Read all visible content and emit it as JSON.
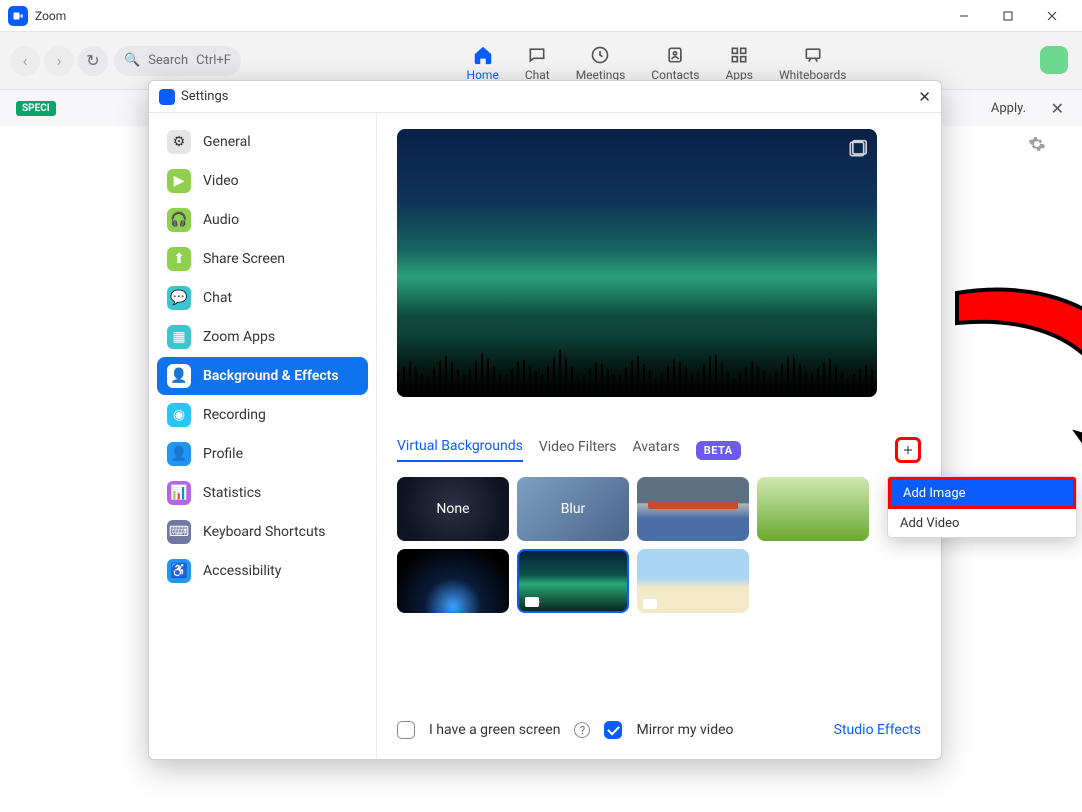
{
  "app": {
    "title": "Zoom"
  },
  "window_controls": {
    "minimize": "minimize",
    "maximize": "maximize",
    "close": "close"
  },
  "toolbar": {
    "search_label": "Search",
    "search_shortcut": "Ctrl+F",
    "tabs": [
      {
        "label": "Home"
      },
      {
        "label": "Chat"
      },
      {
        "label": "Meetings"
      },
      {
        "label": "Contacts"
      },
      {
        "label": "Apps"
      },
      {
        "label": "Whiteboards"
      }
    ]
  },
  "banner": {
    "pill": "SPECI",
    "tail_text": "Apply."
  },
  "settings": {
    "title": "Settings",
    "sidebar": [
      {
        "label": "General",
        "icon": "gear"
      },
      {
        "label": "Video",
        "icon": "video"
      },
      {
        "label": "Audio",
        "icon": "audio"
      },
      {
        "label": "Share Screen",
        "icon": "share"
      },
      {
        "label": "Chat",
        "icon": "chat"
      },
      {
        "label": "Zoom Apps",
        "icon": "apps"
      },
      {
        "label": "Background & Effects",
        "icon": "bg",
        "active": true
      },
      {
        "label": "Recording",
        "icon": "record"
      },
      {
        "label": "Profile",
        "icon": "profile"
      },
      {
        "label": "Statistics",
        "icon": "stats"
      },
      {
        "label": "Keyboard Shortcuts",
        "icon": "keyboard"
      },
      {
        "label": "Accessibility",
        "icon": "a11y"
      }
    ],
    "tabs": {
      "vb": "Virtual Backgrounds",
      "filters": "Video Filters",
      "avatars": "Avatars",
      "beta": "BETA"
    },
    "thumbs": {
      "none": "None",
      "blur": "Blur"
    },
    "checkboxes": {
      "green_screen": "I have a green screen",
      "mirror": "Mirror my video"
    },
    "studio_effects": "Studio Effects",
    "add_menu": {
      "add_image": "Add Image",
      "add_video": "Add Video"
    }
  }
}
